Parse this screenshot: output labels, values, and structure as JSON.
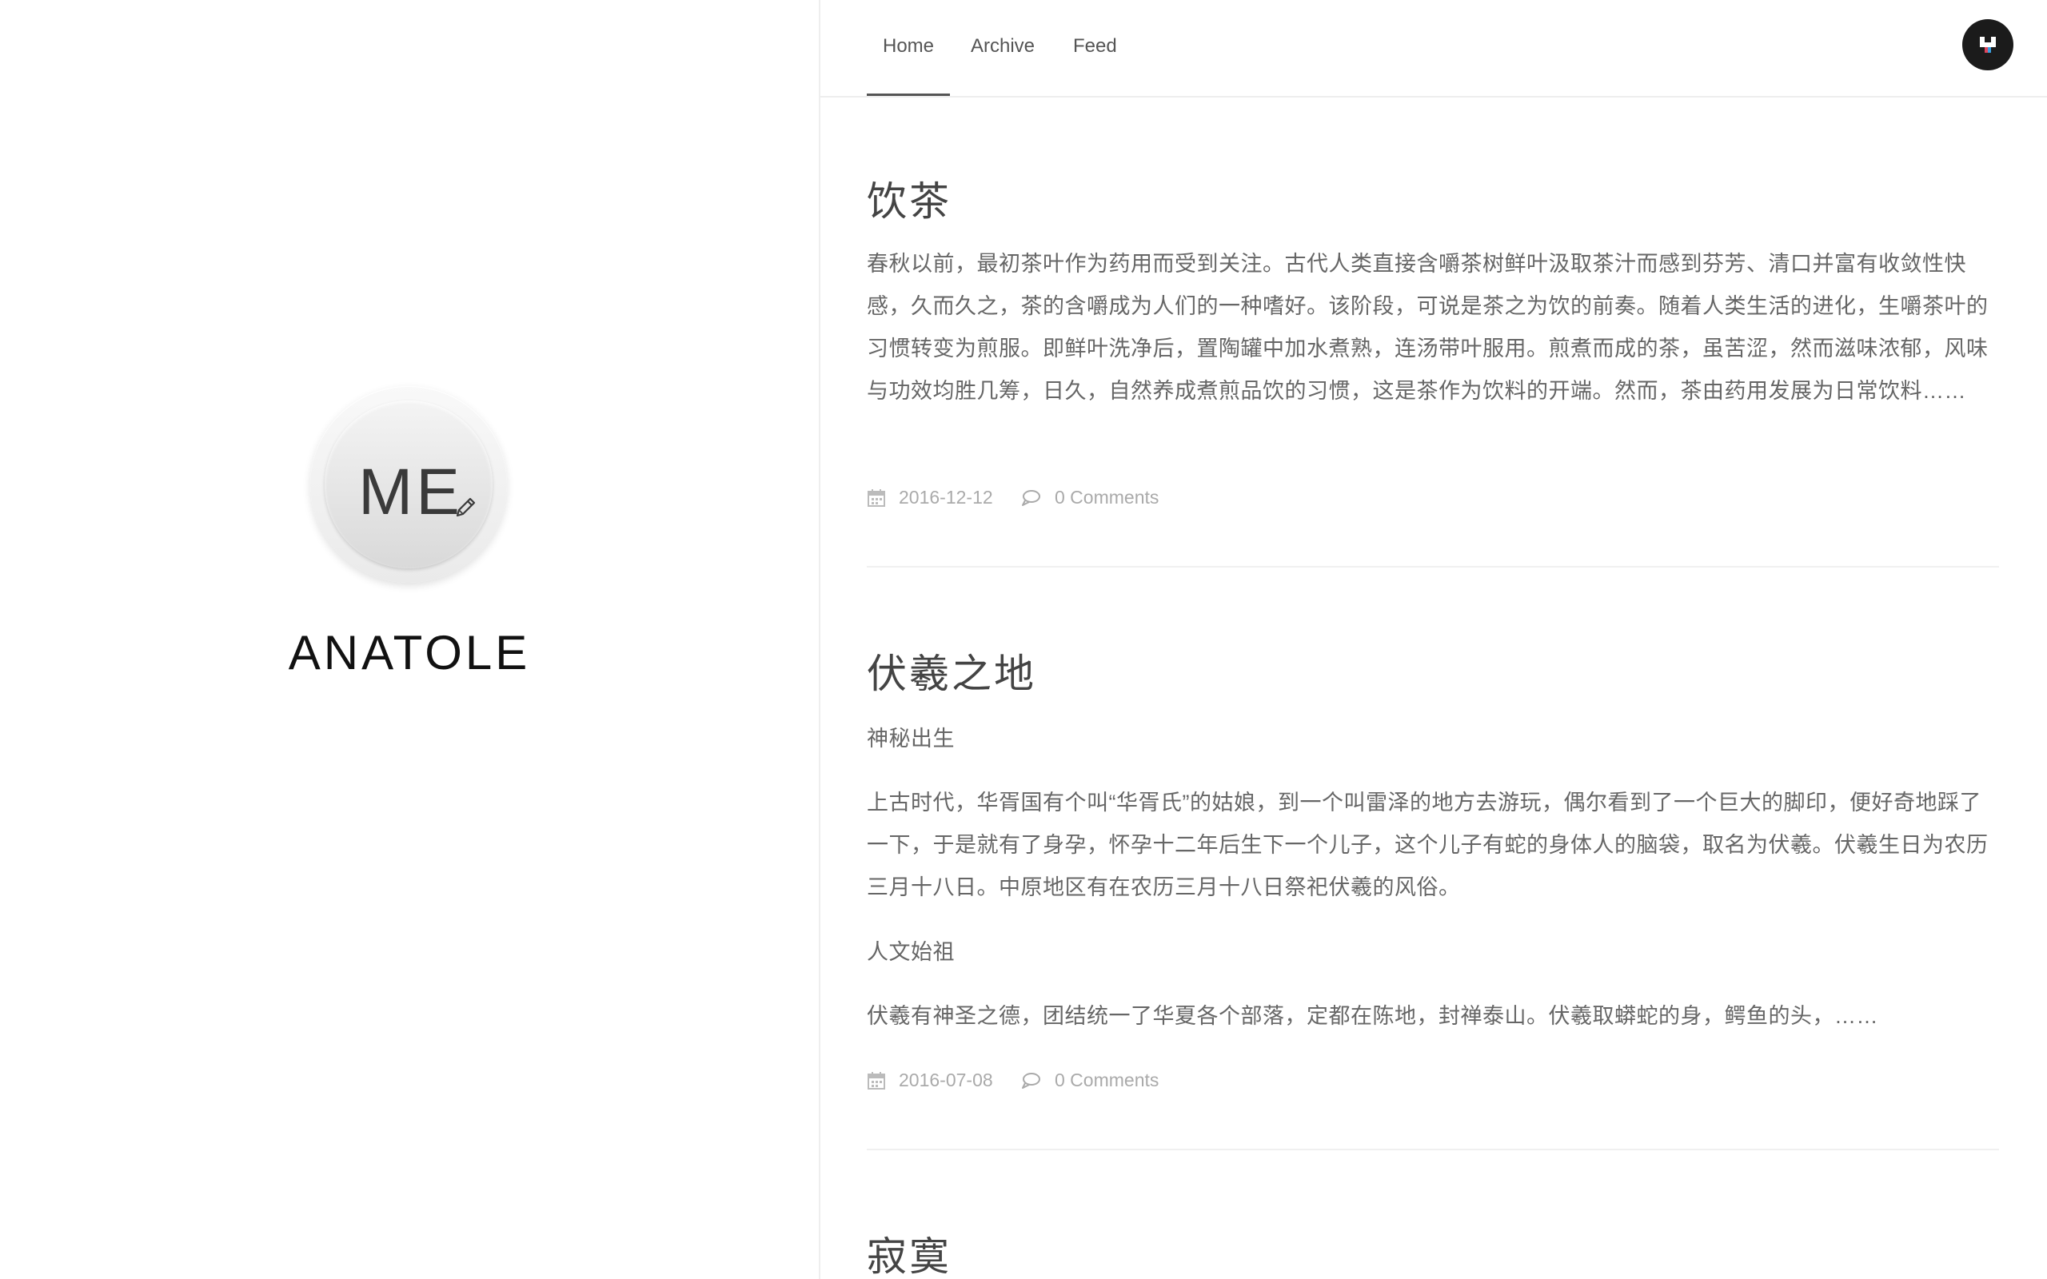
{
  "profile": {
    "avatar_text": "ME",
    "name": "ANATOLE"
  },
  "nav": {
    "items": [
      {
        "label": "Home"
      },
      {
        "label": "Archive"
      },
      {
        "label": "Feed"
      }
    ],
    "active": "Home"
  },
  "posts": [
    {
      "title": "饮茶",
      "paragraphs": [
        "春秋以前，最初茶叶作为药用而受到关注。古代人类直接含嚼茶树鲜叶汲取茶汁而感到芬芳、清口并富有收敛性快感，久而久之，茶的含嚼成为人们的一种嗜好。该阶段，可说是茶之为饮的前奏。随着人类生活的进化，生嚼茶叶的习惯转变为煎服。即鲜叶洗净后，置陶罐中加水煮熟，连汤带叶服用。煎煮而成的茶，虽苦涩，然而滋味浓郁，风味与功效均胜几筹，日久，自然养成煮煎品饮的习惯，这是茶作为饮料的开端。然而，茶由药用发展为日常饮料……"
      ],
      "date": "2016-12-12",
      "comments": "0 Comments"
    },
    {
      "title": "伏羲之地",
      "paragraphs": [
        "神秘出生",
        "上古时代，华胥国有个叫“华胥氏”的姑娘，到一个叫雷泽的地方去游玩，偶尔看到了一个巨大的脚印，便好奇地踩了一下，于是就有了身孕，怀孕十二年后生下一个儿子，这个儿子有蛇的身体人的脑袋，取名为伏羲。伏羲生日为农历三月十八日。中原地区有在农历三月十八日祭祀伏羲的风俗。",
        "人文始祖",
        "伏羲有神圣之德，团结统一了华夏各个部落，定都在陈地，封禅泰山。伏羲取蟒蛇的身，鳄鱼的头，……"
      ],
      "date": "2016-07-08",
      "comments": "0 Comments"
    },
    {
      "title": "寂寞"
    }
  ],
  "icons": {
    "avatar_edit": "pencil-icon",
    "date": "calendar-icon",
    "comments": "comment-bubble-icon",
    "logo": "site-logo-icon"
  },
  "colors": {
    "title": "#444444",
    "body": "#666666",
    "meta": "#aaaaaa",
    "logo_bg": "#1b1b1b"
  }
}
